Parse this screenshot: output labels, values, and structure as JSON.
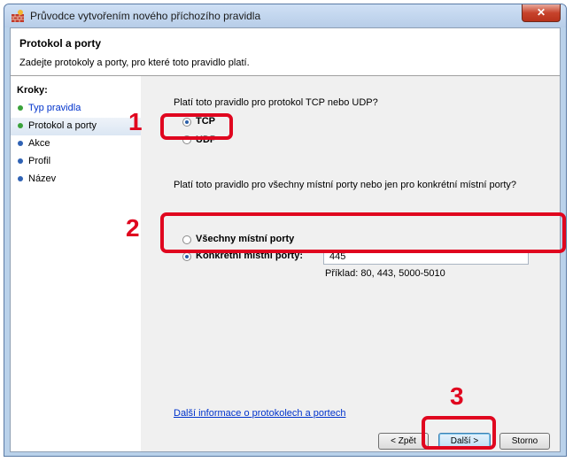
{
  "window": {
    "title": "Průvodce vytvořením nového příchozího pravidla",
    "close_label": "✕"
  },
  "header": {
    "title": "Protokol a porty",
    "subtitle": "Zadejte protokoly a porty, pro které toto pravidlo platí."
  },
  "steps": {
    "title": "Kroky:",
    "items": [
      {
        "label": "Typ pravidla",
        "dot_color": "#3aa23a",
        "link": true
      },
      {
        "label": "Protokol a porty",
        "dot_color": "#3aa23a",
        "link": false
      },
      {
        "label": "Akce",
        "dot_color": "#2f62b4",
        "link": false
      },
      {
        "label": "Profil",
        "dot_color": "#2f62b4",
        "link": false
      },
      {
        "label": "Název",
        "dot_color": "#2f62b4",
        "link": false
      }
    ]
  },
  "protocol": {
    "question": "Platí toto pravidlo pro protokol TCP nebo UDP?",
    "tcp_label": "TCP",
    "udp_label": "UDP"
  },
  "ports": {
    "question": "Platí toto pravidlo pro všechny místní porty nebo jen pro konkrétní místní porty?",
    "all_label": "Všechny místní porty",
    "specific_label": "Konkrétní místní porty:",
    "value": "445",
    "example": "Příklad: 80, 443, 5000-5010"
  },
  "link_text": "Další informace o protokolech a portech",
  "buttons": {
    "back": "< Zpět",
    "next": "Další >",
    "cancel": "Storno"
  },
  "annotations": {
    "n1": "1",
    "n2": "2",
    "n3": "3"
  },
  "colors": {
    "callout": "#e0061f",
    "link": "#0033cc"
  }
}
